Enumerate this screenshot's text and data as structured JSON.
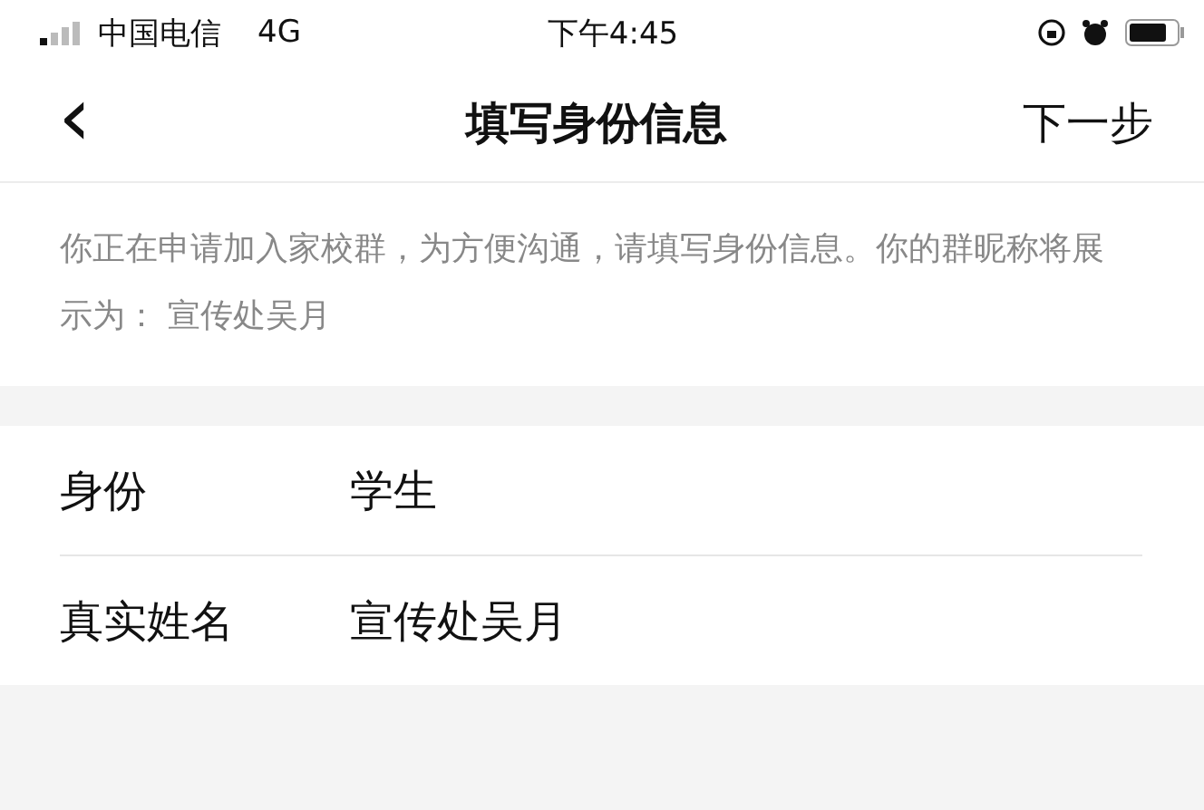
{
  "status_bar": {
    "carrier": "中国电信",
    "network": "4G",
    "time": "下午4:45"
  },
  "nav": {
    "back": "‹",
    "title": "填写身份信息",
    "action": "下一步"
  },
  "notice": "你正在申请加入家校群，为方便沟通，请填写身份信息。你的群昵称将展示为： 宣传处吴月",
  "fields": [
    {
      "label": "身份",
      "value": "学生"
    },
    {
      "label": "真实姓名",
      "value": "宣传处吴月"
    }
  ]
}
